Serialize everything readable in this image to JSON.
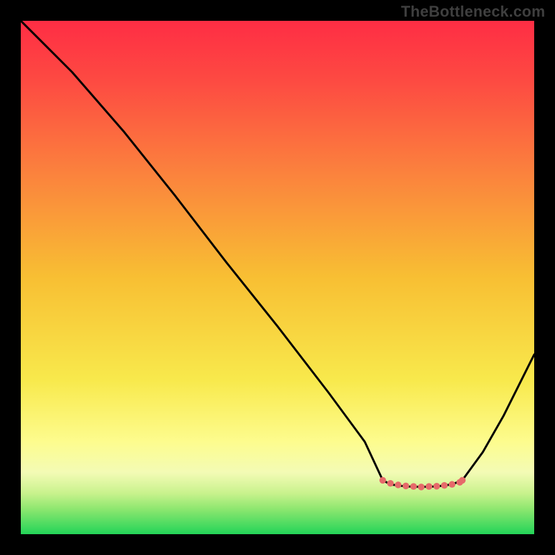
{
  "watermark_text": "TheBottleneck.com",
  "chart_data": {
    "type": "line",
    "title": "",
    "xlabel": "",
    "ylabel": "",
    "xlim": [
      0,
      100
    ],
    "ylim": [
      0,
      100
    ],
    "grid": false,
    "series": [
      {
        "name": "curve-descending",
        "x": [
          0,
          4,
          10,
          20,
          30,
          40,
          50,
          60,
          67,
          70.5
        ],
        "y": [
          100,
          96,
          90,
          78.5,
          66,
          53,
          40.5,
          27.5,
          18,
          10.5
        ]
      },
      {
        "name": "bottom-arc",
        "x": [
          70.5,
          72,
          75,
          78,
          81,
          84,
          86
        ],
        "y": [
          10.5,
          9.7,
          9.3,
          9.2,
          9.3,
          9.7,
          10.5
        ]
      },
      {
        "name": "curve-ascending",
        "x": [
          86,
          90,
          94,
          97,
          100
        ],
        "y": [
          10.5,
          16,
          23,
          29,
          35
        ]
      },
      {
        "name": "dotted-highlight",
        "x": [
          70.5,
          72,
          73.5,
          75,
          76.5,
          78,
          79.5,
          81,
          82.5,
          84,
          85.5,
          86
        ],
        "y": [
          10.5,
          9.9,
          9.6,
          9.4,
          9.3,
          9.2,
          9.3,
          9.35,
          9.5,
          9.7,
          10.1,
          10.5
        ]
      }
    ],
    "colors": {
      "background_top": "#fe2d44",
      "background_mid": "#f8bf33",
      "background_low": "#fdfc8e",
      "background_bottom": "#23d458",
      "curve": "#000000",
      "dot": "#e66a6a"
    }
  }
}
